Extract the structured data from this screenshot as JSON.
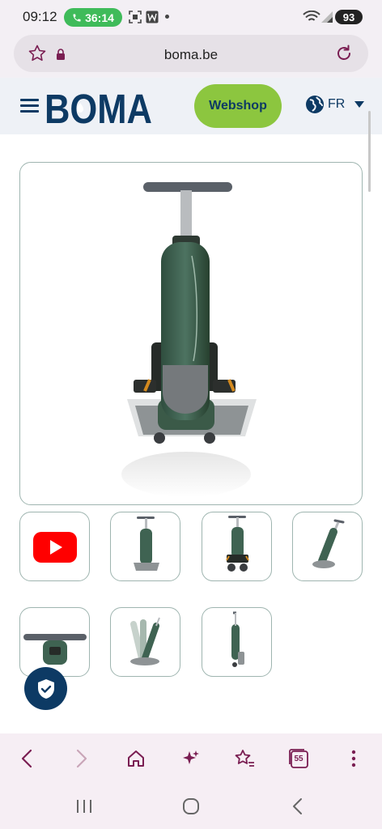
{
  "status_bar": {
    "time": "09:12",
    "call_timer": "36:14",
    "battery": "93"
  },
  "browser": {
    "url": "boma.be",
    "tab_count": "55"
  },
  "header": {
    "logo_text": "BOMA",
    "webshop_label": "Webshop",
    "language": "FR"
  },
  "colors": {
    "brand_navy": "#0d3a64",
    "brand_green": "#8cc63f",
    "browser_accent": "#7a1e52",
    "call_green": "#3fbb5a"
  },
  "gallery": {
    "thumbnails": [
      {
        "name": "video-thumbnail",
        "icon": "youtube-play-icon"
      },
      {
        "name": "front-view"
      },
      {
        "name": "front-lit-view"
      },
      {
        "name": "side-tilted-view"
      },
      {
        "name": "top-handle-view"
      },
      {
        "name": "folding-motion-view"
      },
      {
        "name": "folded-side-view"
      }
    ]
  }
}
